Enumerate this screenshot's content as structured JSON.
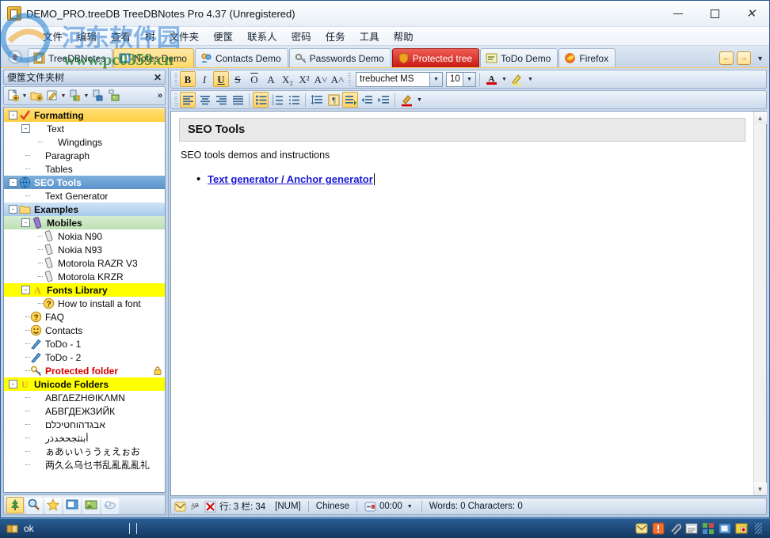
{
  "window": {
    "title": "DEMO_PRO.treeDB TreeDBNotes Pro 4.37 (Unregistered)",
    "app_icon": "treedbnotes-icon",
    "minimize_label": "—",
    "maximize_label": "□",
    "close_label": "✕"
  },
  "menubar": {
    "items": [
      {
        "label": "文件"
      },
      {
        "label": "编辑"
      },
      {
        "label": "查看"
      },
      {
        "label": "树"
      },
      {
        "label": "文件夹"
      },
      {
        "label": "便筺"
      },
      {
        "label": "联系人"
      },
      {
        "label": "密码"
      },
      {
        "label": "任务"
      },
      {
        "label": "工具"
      },
      {
        "label": "帮助"
      }
    ]
  },
  "tabbar": {
    "home_icon": "home-tab-icon",
    "tabs": [
      {
        "label": "TreeDBNotes",
        "icon": "book-icon",
        "state": "normal"
      },
      {
        "label": "Notes Demo",
        "icon": "notes-icon",
        "state": "active-yellow"
      },
      {
        "label": "Contacts Demo",
        "icon": "contacts-icon",
        "state": "normal"
      },
      {
        "label": "Passwords Demo",
        "icon": "key-icon",
        "state": "normal"
      },
      {
        "label": "Protected tree",
        "icon": "shield-icon",
        "state": "active-red"
      },
      {
        "label": "ToDo Demo",
        "icon": "todo-icon",
        "state": "normal"
      },
      {
        "label": "Firefox",
        "icon": "firefox-icon",
        "state": "normal"
      }
    ],
    "nav_prev": "←",
    "nav_next": "→",
    "nav_more": "▼"
  },
  "sidebar": {
    "header": {
      "title": "便筺文件夹树",
      "close_label": "✕"
    },
    "toolbar": {
      "buttons": [
        {
          "name": "new-note-icon"
        },
        {
          "name": "new-note-dropdown-icon"
        },
        {
          "name": "new-folder-icon"
        },
        {
          "name": "edit-note-icon"
        },
        {
          "name": "edit-dropdown-icon"
        },
        {
          "name": "move-node-icon"
        },
        {
          "name": "move-dropdown-icon"
        },
        {
          "name": "copy-node-icon"
        },
        {
          "name": "tree-image-icon"
        }
      ],
      "more_label": "»"
    },
    "tree": [
      {
        "label": "Formatting",
        "level": 0,
        "icon": "check-icon",
        "expander": "-",
        "style": "hl-yellow",
        "bold": true
      },
      {
        "label": "Text",
        "level": 1,
        "icon": "",
        "expander": "-",
        "style": "",
        "bold": false
      },
      {
        "label": "Wingdings",
        "level": 2,
        "icon": "",
        "expander": "",
        "style": "",
        "bold": false
      },
      {
        "label": "Paragraph",
        "level": 1,
        "icon": "",
        "expander": "",
        "style": "",
        "bold": false
      },
      {
        "label": "Tables",
        "level": 1,
        "icon": "",
        "expander": "",
        "style": "",
        "bold": false
      },
      {
        "label": "SEO Tools",
        "level": 0,
        "icon": "globe-icon",
        "expander": "-",
        "style": "hl-sel",
        "bold": true
      },
      {
        "label": "Text Generator",
        "level": 1,
        "icon": "",
        "expander": "",
        "style": "",
        "bold": false
      },
      {
        "label": "Examples",
        "level": 0,
        "icon": "folder-icon",
        "expander": "-",
        "style": "hl-blue",
        "bold": true
      },
      {
        "label": "Mobiles",
        "level": 1,
        "icon": "mobile-icon",
        "expander": "-",
        "style": "hl-green",
        "bold": true
      },
      {
        "label": "Nokia N90",
        "level": 2,
        "icon": "phone-icon",
        "expander": "",
        "style": "",
        "bold": false
      },
      {
        "label": "Nokia N93",
        "level": 2,
        "icon": "phone-icon",
        "expander": "",
        "style": "",
        "bold": false
      },
      {
        "label": "Motorola RAZR V3",
        "level": 2,
        "icon": "phone-icon",
        "expander": "",
        "style": "",
        "bold": false
      },
      {
        "label": "Motorola KRZR",
        "level": 2,
        "icon": "phone-icon",
        "expander": "",
        "style": "",
        "bold": false
      },
      {
        "label": "Fonts Library",
        "level": 1,
        "icon": "font-a-icon",
        "expander": "-",
        "style": "hl-yellow2",
        "bold": true
      },
      {
        "label": "How to install a font",
        "level": 2,
        "icon": "question-icon",
        "expander": "",
        "style": "",
        "bold": false
      },
      {
        "label": "FAQ",
        "level": 1,
        "icon": "question-icon",
        "expander": "",
        "style": "",
        "bold": false
      },
      {
        "label": "Contacts",
        "level": 1,
        "icon": "smiley-icon",
        "expander": "",
        "style": "",
        "bold": false
      },
      {
        "label": "ToDo - 1",
        "level": 1,
        "icon": "pencil-icon",
        "expander": "",
        "style": "",
        "bold": false
      },
      {
        "label": "ToDo - 2",
        "level": 1,
        "icon": "pencil-icon",
        "expander": "",
        "style": "",
        "bold": false
      },
      {
        "label": "Protected folder",
        "level": 1,
        "icon": "key-icon",
        "expander": "",
        "style": "locked",
        "bold": true
      },
      {
        "label": "Unicode Folders",
        "level": 0,
        "icon": "unicode-icon",
        "expander": "-",
        "style": "hl-yellow2",
        "bold": true
      },
      {
        "label": "ΑΒΓΔΕΖΗΘΙΚΛΜΝ",
        "level": 1,
        "icon": "",
        "expander": "",
        "style": "",
        "bold": false
      },
      {
        "label": "АБВГДЕЖЗИЙК",
        "level": 1,
        "icon": "",
        "expander": "",
        "style": "",
        "bold": false
      },
      {
        "label": "אבגדהוחטיכלם",
        "level": 1,
        "icon": "",
        "expander": "",
        "style": "",
        "bold": false
      },
      {
        "label": "أبتثجحخدذر",
        "level": 1,
        "icon": "",
        "expander": "",
        "style": "",
        "bold": false
      },
      {
        "label": "ぁあぃいぅうぇえぉお",
        "level": 1,
        "icon": "",
        "expander": "",
        "style": "",
        "bold": false
      },
      {
        "label": "两久么乌乜书乱亂亂亂礼",
        "level": 1,
        "icon": "",
        "expander": "",
        "style": "",
        "bold": false
      }
    ],
    "bottom_icons": [
      {
        "name": "tree-view-icon",
        "selected": true
      },
      {
        "name": "search-icon",
        "selected": false
      },
      {
        "name": "favorites-star-icon",
        "selected": false
      },
      {
        "name": "notes-panel-icon",
        "selected": false
      },
      {
        "name": "images-panel-icon",
        "selected": false
      },
      {
        "name": "cloud-panel-icon",
        "selected": false
      }
    ]
  },
  "editor": {
    "toolbar_row1": [
      {
        "name": "bold-button",
        "label": "B",
        "state": "on"
      },
      {
        "name": "italic-button",
        "label": "I",
        "state": "off"
      },
      {
        "name": "underline-button",
        "label": "U",
        "state": "on"
      },
      {
        "name": "strikethrough-button",
        "label": "S",
        "state": "off"
      },
      {
        "name": "overline-button",
        "label": "O",
        "state": "off"
      },
      {
        "name": "font-color-a-button",
        "label": "A",
        "state": "off"
      },
      {
        "name": "subscript-button",
        "label": "X₂",
        "state": "off"
      },
      {
        "name": "superscript-button",
        "label": "X²",
        "state": "off"
      },
      {
        "name": "decrease-font-button",
        "label": "A˅",
        "state": "off"
      },
      {
        "name": "increase-font-button",
        "label": "A˄",
        "state": "off"
      }
    ],
    "font_name": "trebuchet MS",
    "font_size": "10",
    "text_color_button": "A",
    "highlight_button": "highlighter-icon",
    "toolbar_row2": [
      {
        "name": "align-left-button",
        "state": "on"
      },
      {
        "name": "align-center-button",
        "state": "off"
      },
      {
        "name": "align-right-button",
        "state": "off"
      },
      {
        "name": "align-justify-button",
        "state": "off"
      },
      {
        "name": "bullet-list-button",
        "state": "on"
      },
      {
        "name": "numbered-list-button",
        "state": "off"
      },
      {
        "name": "plain-list-button",
        "state": "off"
      },
      {
        "name": "line-spacing-button",
        "state": "off"
      },
      {
        "name": "paragraph-marks-button",
        "state": "off"
      },
      {
        "name": "paragraph-settings-button",
        "state": "on"
      },
      {
        "name": "decrease-indent-button",
        "state": "off"
      },
      {
        "name": "increase-indent-button",
        "state": "off"
      },
      {
        "name": "background-color-button",
        "state": "off"
      }
    ],
    "document": {
      "title": "SEO Tools",
      "paragraph": "SEO tools demos and instructions",
      "bullet": "•",
      "link": "Text generator / Anchor generator"
    },
    "scroll_up": "▲",
    "scroll_down": "▼"
  },
  "statusbar": {
    "icons": [
      "mail-status-icon",
      "spellcheck-icon",
      "no-spell-icon"
    ],
    "position": "行: 3 栏: 34",
    "num_lock": "[NUM]",
    "language": "Chinese",
    "timer_icon": "timer-icon",
    "timer": "00:00",
    "timer_dropdown": "▼",
    "counts": "Words: 0 Characters: 0"
  },
  "taskbar": {
    "status_icon": "book-status-icon",
    "status_label": "ok",
    "tray_icons": [
      "mail-tray-icon",
      "alert-tray-icon",
      "clip-tray-icon",
      "calendar-tray-icon",
      "apps-tray-icon",
      "window-tray-icon",
      "record-tray-icon"
    ]
  },
  "watermark": {
    "site": "河东软件园",
    "url": "www.pc0359.cn"
  },
  "colors": {
    "accent_blue": "#2f5e96",
    "tab_yellow": "#ffd966",
    "tab_red": "#c81a12",
    "link_blue": "#1a1ad0",
    "protected_red": "#d60000",
    "highlight_yellow": "#ffff00"
  }
}
